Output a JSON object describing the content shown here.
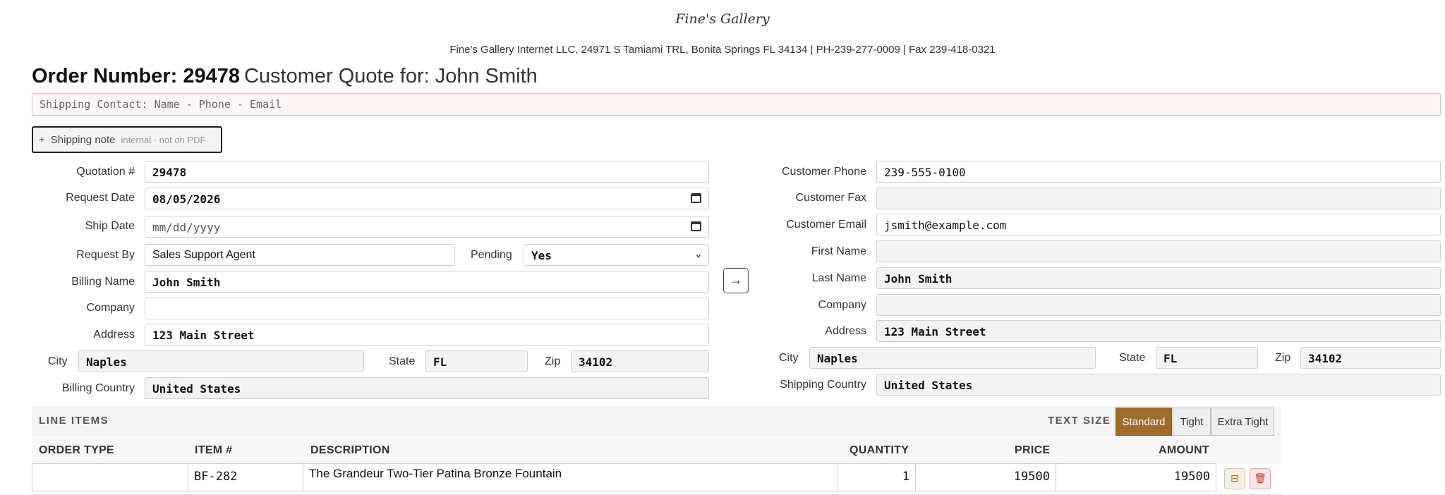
{
  "header": {
    "logo_text": "Fine's Gallery",
    "company_line": "Fine's Gallery Internet LLC, 24971 S Tamiami TRL, Bonita Springs FL 34134 | PH-239-277-0009 | Fax 239-418-0321"
  },
  "order": {
    "number_label": "Order Number: 29478",
    "customer_label": "Customer Quote for: John Smith"
  },
  "shipping_contact": {
    "placeholder": "Shipping Contact: Name - Phone - Email"
  },
  "shipping_note": {
    "plus": "+",
    "label": "Shipping note",
    "hint": "internal · not on PDF"
  },
  "billing": {
    "quotation_label": "Quotation #",
    "quotation": "29478",
    "request_date_label": "Request Date",
    "request_date": "08/05/2026",
    "ship_date_label": "Ship Date",
    "ship_date": "mm/dd/yyyy",
    "request_by_label": "Request By",
    "request_by": "Sales Support Agent",
    "pending_label": "Pending",
    "pending": "Yes",
    "name_label": "Billing Name",
    "name": "John Smith",
    "company_label": "Company",
    "company": "",
    "address_label": "Address",
    "address": "123 Main Street",
    "city_label": "City",
    "city": "Naples",
    "state_label": "State",
    "state": "FL",
    "zip_label": "Zip",
    "zip": "34102",
    "country_label": "Billing Country",
    "country": "United States"
  },
  "copy_button": {
    "icon": "arrow-right-icon",
    "glyph": "→"
  },
  "shipping": {
    "phone_label": "Customer Phone",
    "phone": "239-555-0100",
    "fax_label": "Customer Fax",
    "fax": "",
    "email_label": "Customer Email",
    "email": "jsmith@example.com",
    "first_name_label": "First Name",
    "first_name": "",
    "last_name_label": "Last Name",
    "last_name": "John Smith",
    "company_label": "Company",
    "company": "",
    "address_label": "Address",
    "address": "123 Main Street",
    "city_label": "City",
    "city": "Naples",
    "state_label": "State",
    "state": "FL",
    "zip_label": "Zip",
    "zip": "34102",
    "country_label": "Shipping Country",
    "country": "United States"
  },
  "line_items": {
    "title": "LINE ITEMS",
    "text_size_label": "TEXT SIZE",
    "text_size_options": [
      "Standard",
      "Tight",
      "Extra Tight"
    ],
    "text_size_selected": "Standard",
    "columns": [
      "ORDER TYPE",
      "ITEM #",
      "DESCRIPTION",
      "QUANTITY",
      "PRICE",
      "AMOUNT"
    ],
    "rows": [
      {
        "order_type": "",
        "item": "BF-282",
        "description": "The Grandeur Two-Tier Patina Bronze Fountain",
        "quantity": "1",
        "price": "19500",
        "amount": "19500"
      }
    ],
    "row_actions": {
      "collapse_glyph": "⊟",
      "delete_glyph": "🗑"
    }
  },
  "colors": {
    "accent": "#a06c2c",
    "contact_border": "#f2b8bd",
    "delete": "#c0392b"
  }
}
